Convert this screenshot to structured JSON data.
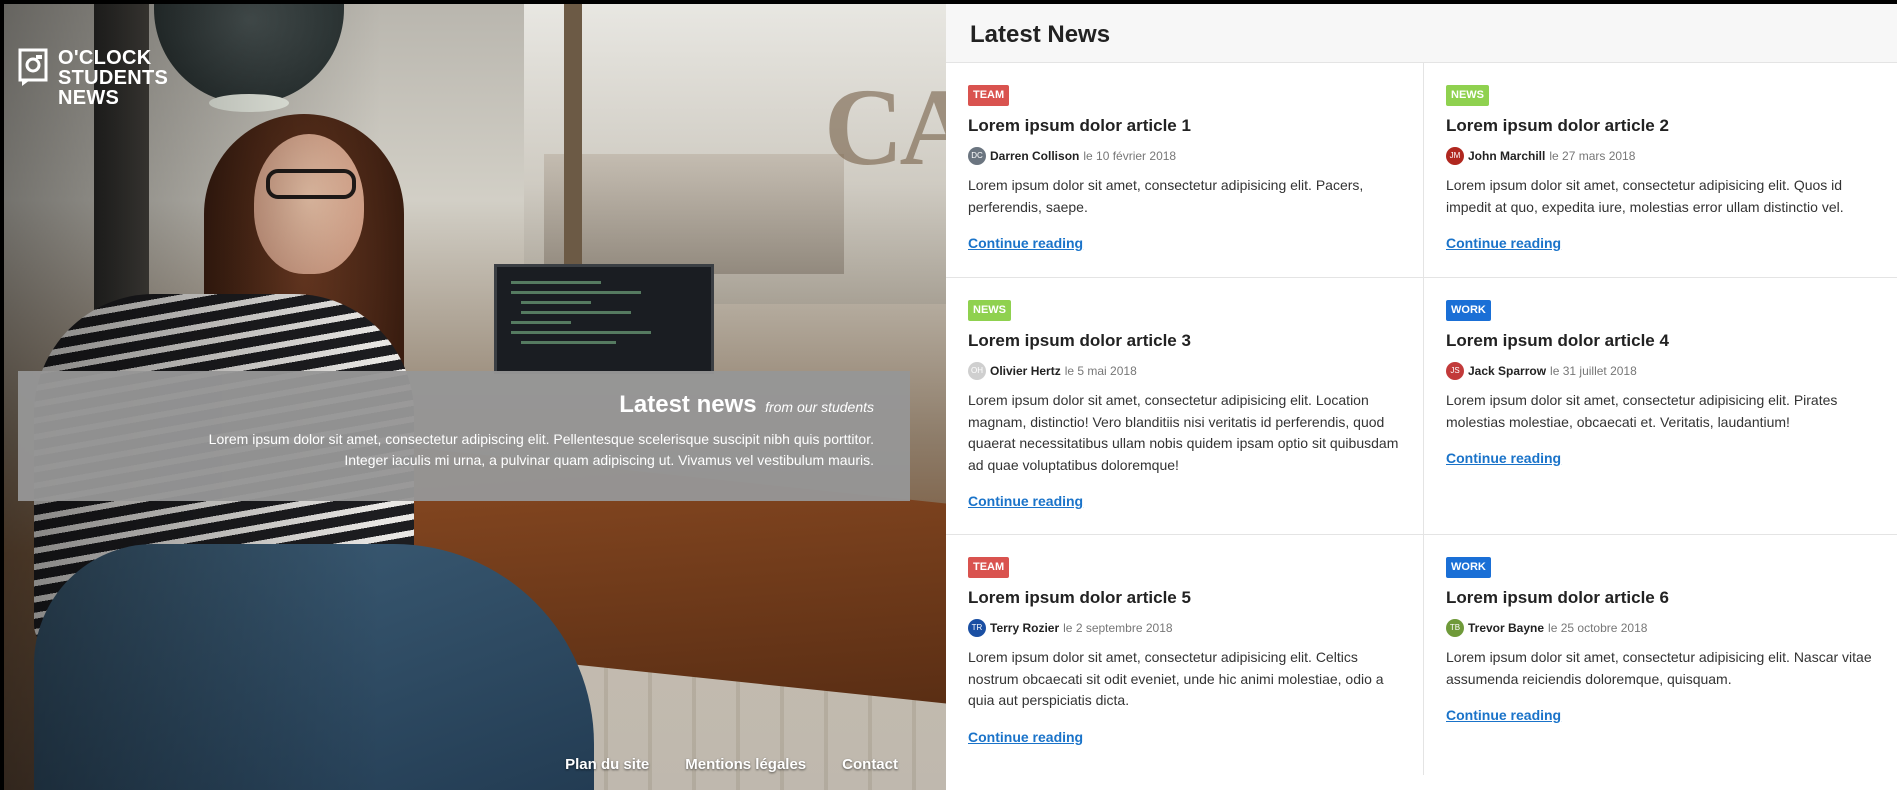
{
  "brand": {
    "logo_line1": "O'CLOCK",
    "logo_line2": "STUDENTS",
    "logo_line3": "NEWS"
  },
  "hero": {
    "title": "Latest news",
    "subtitle": "from our students",
    "text_line1": "Lorem ipsum dolor sit amet, consectetur adipiscing elit. Pellentesque scelerisque suscipit nibh quis porttitor.",
    "text_line2": "Integer iaculis mi urna, a pulvinar quam adipiscing ut. Vivamus vel vestibulum mauris.",
    "background_text": "CA"
  },
  "footer": {
    "links": [
      "Plan du site",
      "Mentions légales",
      "Contact"
    ]
  },
  "news": {
    "heading": "Latest News",
    "read_more": "Continue reading",
    "articles": [
      {
        "badge": "Team",
        "badge_color": "#d9534f",
        "title": "Lorem ipsum dolor article 1",
        "author": "Darren Collison",
        "avatar_color": "#6b7580",
        "avatar_initials": "DC",
        "date": "le 10 février 2018",
        "excerpt": "Lorem ipsum dolor sit amet, consectetur adipisicing elit. Pacers, perferendis, saepe."
      },
      {
        "badge": "News",
        "badge_color": "#8fd14f",
        "title": "Lorem ipsum dolor article 2",
        "author": "John Marchill",
        "avatar_color": "#b0271f",
        "avatar_initials": "JM",
        "date": "le 27 mars 2018",
        "excerpt": "Lorem ipsum dolor sit amet, consectetur adipisicing elit. Quos id impedit at quo, expedita iure, molestias error ullam distinctio vel."
      },
      {
        "badge": "News",
        "badge_color": "#8fd14f",
        "title": "Lorem ipsum dolor article 3",
        "author": "Olivier Hertz",
        "avatar_color": "#cfcfcf",
        "avatar_initials": "OH",
        "date": "le 5 mai 2018",
        "excerpt": "Lorem ipsum dolor sit amet, consectetur adipisicing elit. Location magnam, distinctio! Vero blanditiis nisi veritatis id perferendis, quod quaerat necessitatibus ullam nobis quidem ipsam optio sit quibusdam ad quae voluptatibus doloremque!"
      },
      {
        "badge": "Work",
        "badge_color": "#1a6fd6",
        "title": "Lorem ipsum dolor article 4",
        "author": "Jack Sparrow",
        "avatar_color": "#c23a3a",
        "avatar_initials": "JS",
        "date": "le 31 juillet 2018",
        "excerpt": "Lorem ipsum dolor sit amet, consectetur adipisicing elit. Pirates molestias molestiae, obcaecati et. Veritatis, laudantium!"
      },
      {
        "badge": "Team",
        "badge_color": "#d9534f",
        "title": "Lorem ipsum dolor article 5",
        "author": "Terry Rozier",
        "avatar_color": "#1a4fa3",
        "avatar_initials": "TR",
        "date": "le 2 septembre 2018",
        "excerpt": "Lorem ipsum dolor sit amet, consectetur adipisicing elit. Celtics nostrum obcaecati sit odit eveniet, unde hic animi molestiae, odio a quia aut perspiciatis dicta."
      },
      {
        "badge": "Work",
        "badge_color": "#1a6fd6",
        "title": "Lorem ipsum dolor article 6",
        "author": "Trevor Bayne",
        "avatar_color": "#6f9a3a",
        "avatar_initials": "TB",
        "date": "le 25 octobre 2018",
        "excerpt": "Lorem ipsum dolor sit amet, consectetur adipisicing elit. Nascar vitae assumenda reiciendis doloremque, quisquam."
      }
    ]
  }
}
